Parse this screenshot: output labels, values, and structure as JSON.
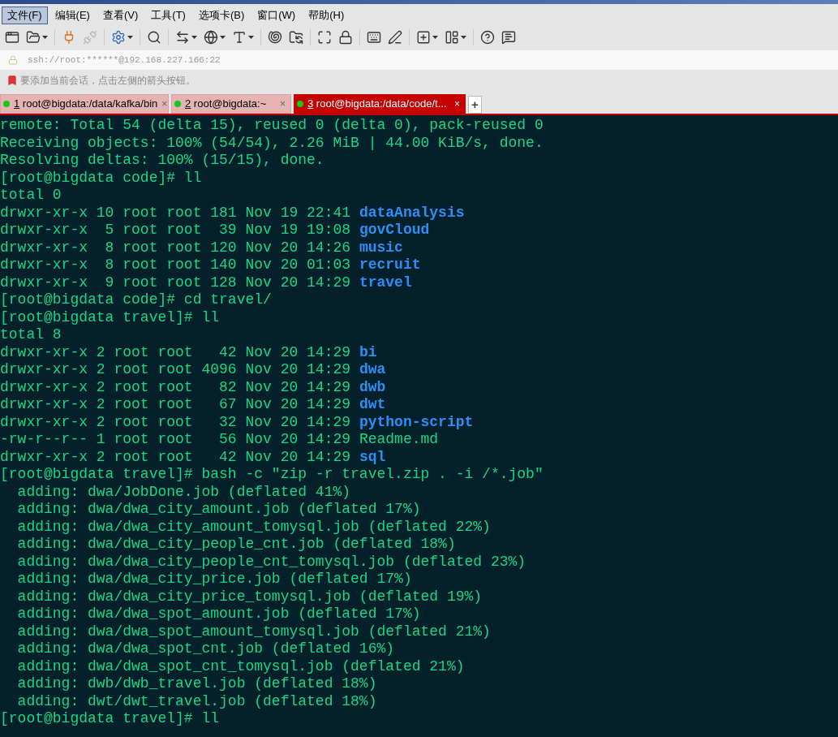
{
  "menu": [
    {
      "label": "文件(F)",
      "selected": true
    },
    {
      "label": "编辑(E)",
      "selected": false
    },
    {
      "label": "查看(V)",
      "selected": false
    },
    {
      "label": "工具(T)",
      "selected": false
    },
    {
      "label": "选项卡(B)",
      "selected": false
    },
    {
      "label": "窗口(W)",
      "selected": false
    },
    {
      "label": "帮助(H)",
      "selected": false
    }
  ],
  "address": {
    "value": "ssh://root:******@192.168.227.166:22"
  },
  "hint": "要添加当前会话，点击左侧的箭头按钮。",
  "tabs": [
    {
      "number": "1",
      "label": " root@bigdata:/data/kafka/bin",
      "selected": false,
      "close": "×"
    },
    {
      "number": "2",
      "label": " root@bigdata:~",
      "selected": false,
      "close": "×"
    },
    {
      "number": "3",
      "label": " root@bigdata:/data/code/t...",
      "selected": true,
      "close": "×"
    }
  ],
  "new_tab": "+",
  "terminal": [
    {
      "text": "remote: Total 54 (delta 15), reused 0 (delta 0), pack-reused 0"
    },
    {
      "text": "Receiving objects: 100% (54/54), 2.26 MiB | 44.00 KiB/s, done."
    },
    {
      "text": "Resolving deltas: 100% (15/15), done."
    },
    {
      "text": "[root@bigdata code]# ll"
    },
    {
      "text": "total 0"
    },
    {
      "text": "drwxr-xr-x 10 root root 181 Nov 19 22:41 ",
      "entry": "dataAnalysis",
      "kind": "dir"
    },
    {
      "text": "drwxr-xr-x  5 root root  39 Nov 19 19:08 ",
      "entry": "govCloud",
      "kind": "dir"
    },
    {
      "text": "drwxr-xr-x  8 root root 120 Nov 20 14:26 ",
      "entry": "music",
      "kind": "dir"
    },
    {
      "text": "drwxr-xr-x  8 root root 140 Nov 20 01:03 ",
      "entry": "recruit",
      "kind": "dir"
    },
    {
      "text": "drwxr-xr-x  9 root root 128 Nov 20 14:29 ",
      "entry": "travel",
      "kind": "dir"
    },
    {
      "text": "[root@bigdata code]# cd travel/"
    },
    {
      "text": "[root@bigdata travel]# ll"
    },
    {
      "text": "total 8"
    },
    {
      "text": "drwxr-xr-x 2 root root   42 Nov 20 14:29 ",
      "entry": "bi",
      "kind": "dir"
    },
    {
      "text": "drwxr-xr-x 2 root root 4096 Nov 20 14:29 ",
      "entry": "dwa",
      "kind": "dir"
    },
    {
      "text": "drwxr-xr-x 2 root root   82 Nov 20 14:29 ",
      "entry": "dwb",
      "kind": "dir"
    },
    {
      "text": "drwxr-xr-x 2 root root   67 Nov 20 14:29 ",
      "entry": "dwt",
      "kind": "dir"
    },
    {
      "text": "drwxr-xr-x 2 root root   32 Nov 20 14:29 ",
      "entry": "python-script",
      "kind": "dir"
    },
    {
      "text": "-rw-r--r-- 1 root root   56 Nov 20 14:29 ",
      "entry": "Readme.md",
      "kind": "file"
    },
    {
      "text": "drwxr-xr-x 2 root root   42 Nov 20 14:29 ",
      "entry": "sql",
      "kind": "dir"
    },
    {
      "text": "[root@bigdata travel]# bash -c \"zip -r travel.zip . -i /*.job\""
    },
    {
      "text": "  adding: dwa/JobDone.job (deflated 41%)"
    },
    {
      "text": "  adding: dwa/dwa_city_amount.job (deflated 17%)"
    },
    {
      "text": "  adding: dwa/dwa_city_amount_tomysql.job (deflated 22%)"
    },
    {
      "text": "  adding: dwa/dwa_city_people_cnt.job (deflated 18%)"
    },
    {
      "text": "  adding: dwa/dwa_city_people_cnt_tomysql.job (deflated 23%)"
    },
    {
      "text": "  adding: dwa/dwa_city_price.job (deflated 17%)"
    },
    {
      "text": "  adding: dwa/dwa_city_price_tomysql.job (deflated 19%)"
    },
    {
      "text": "  adding: dwa/dwa_spot_amount.job (deflated 17%)"
    },
    {
      "text": "  adding: dwa/dwa_spot_amount_tomysql.job (deflated 21%)"
    },
    {
      "text": "  adding: dwa/dwa_spot_cnt.job (deflated 16%)"
    },
    {
      "text": "  adding: dwa/dwa_spot_cnt_tomysql.job (deflated 21%)"
    },
    {
      "text": "  adding: dwb/dwb_travel.job (deflated 18%)"
    },
    {
      "text": "  adding: dwt/dwt_travel.job (deflated 18%)"
    },
    {
      "text": "[root@bigdata travel]# ll"
    }
  ]
}
